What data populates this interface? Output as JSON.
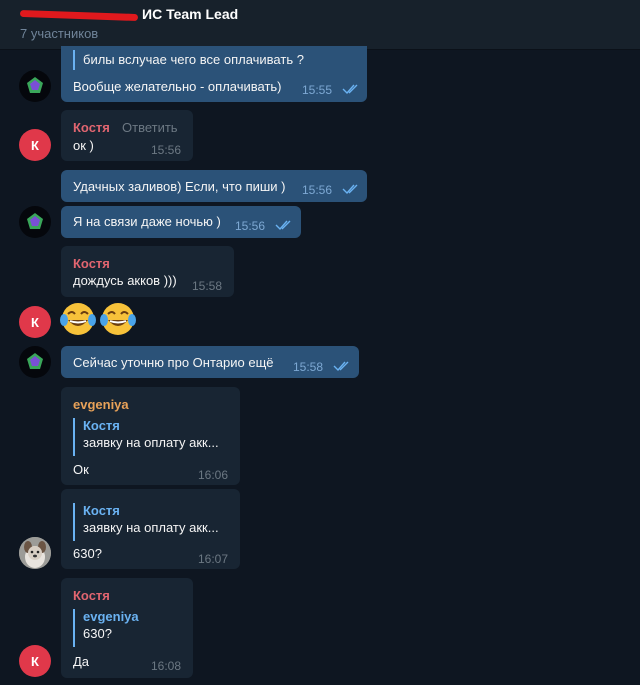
{
  "header": {
    "title": "ИС Team Lead",
    "subtitle": "7 участников"
  },
  "messages": {
    "m1": {
      "line1": "билы вслучае чего все оплачивать ?",
      "line2": "Вообще желательно - оплачивать)",
      "time": "15:55"
    },
    "m2": {
      "sender": "Костя",
      "reply_label": "Ответить",
      "text": "ок )",
      "time": "15:56"
    },
    "m3": {
      "text": "Удачных заливов) Если, что пиши )",
      "time": "15:56"
    },
    "m4": {
      "text": "Я на связи даже ночью )",
      "time": "15:56"
    },
    "m5": {
      "sender": "Костя",
      "text": "дождусь акков )))",
      "time": "15:58"
    },
    "m6": {
      "emoji": "😂😂"
    },
    "m7": {
      "text": "Сейчас уточню про Онтарио ещё",
      "time": "15:58"
    },
    "m8": {
      "sender": "evgeniya",
      "quote_name": "Костя",
      "quote_text": "заявку на оплату акк...",
      "text": "Ок",
      "time": "16:06"
    },
    "m9": {
      "quote_name": "Костя",
      "quote_text": "заявку на оплату акк...",
      "text": "630?",
      "time": "16:07"
    },
    "m10": {
      "sender": "Костя",
      "quote_name": "evgeniya",
      "quote_text": "630?",
      "text": "Да",
      "time": "16:08"
    }
  },
  "avatars": {
    "kostya_initial": "К"
  },
  "colors": {
    "background": "#0e1621",
    "header": "#17212b",
    "outgoing_bubble": "#2b5278",
    "incoming_bubble": "#182533",
    "kostya_name": "#e06570",
    "evgeniya_name": "#e8a259",
    "quote_accent": "#6ab2f2",
    "avatar_red": "#e0384a"
  }
}
